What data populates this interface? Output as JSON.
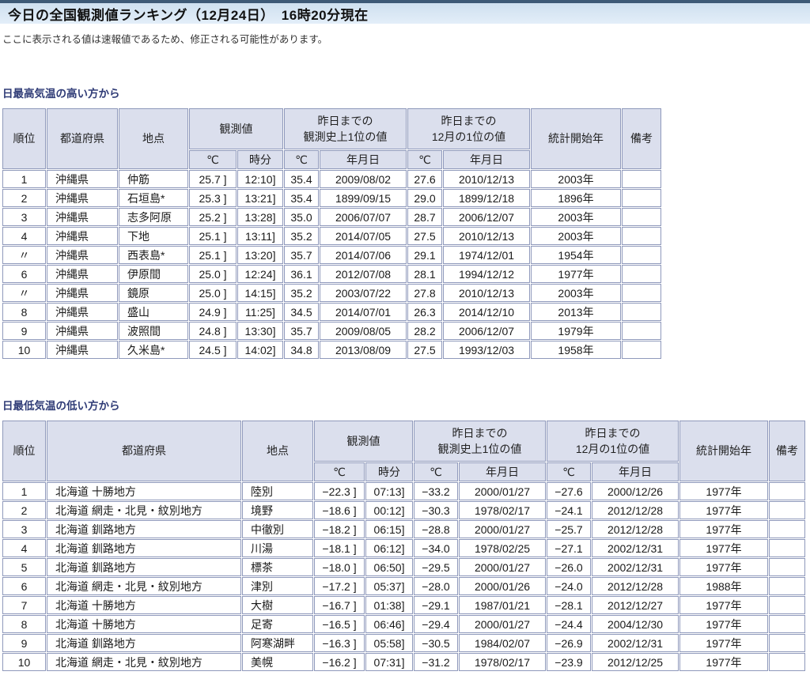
{
  "page": {
    "title": "今日の全国観測値ランキング（12月24日）　16時20分現在",
    "notice": "ここに表示される値は速報値であるため、修正される可能性があります。"
  },
  "colors": {
    "titlebar_top_border": "#3e5a76",
    "titlebar_bg": "#d9e8f5",
    "header_cell_bg": "#dbdfed",
    "table_border": "#8f99bb",
    "section_heading_text": "#2f3b76"
  },
  "columns": {
    "rank": "順位",
    "prefecture": "都道府県",
    "station": "地点",
    "observed": "観測値",
    "record_all_line1": "昨日までの",
    "record_all_line2": "観測史上1位の値",
    "record_dec_line1": "昨日までの",
    "record_dec_line2": "12月の1位の値",
    "stats_start": "統計開始年",
    "remarks": "備考",
    "temp_unit": "℃",
    "time_unit": "時分",
    "date_unit": "年月日"
  },
  "max_table": {
    "heading": "日最高気温の高い方から",
    "rows": [
      [
        "1",
        "沖縄県",
        "仲筋",
        "25.7 ]",
        "12:10]",
        "35.4",
        "2009/08/02",
        "27.6",
        "2010/12/13",
        "2003年",
        ""
      ],
      [
        "2",
        "沖縄県",
        "石垣島*",
        "25.3 ]",
        "13:21]",
        "35.4",
        "1899/09/15",
        "29.0",
        "1899/12/18",
        "1896年",
        ""
      ],
      [
        "3",
        "沖縄県",
        "志多阿原",
        "25.2 ]",
        "13:28]",
        "35.0",
        "2006/07/07",
        "28.7",
        "2006/12/07",
        "2003年",
        ""
      ],
      [
        "4",
        "沖縄県",
        "下地",
        "25.1 ]",
        "13:11]",
        "35.2",
        "2014/07/05",
        "27.5",
        "2010/12/13",
        "2003年",
        ""
      ],
      [
        "〃",
        "沖縄県",
        "西表島*",
        "25.1 ]",
        "13:20]",
        "35.7",
        "2014/07/06",
        "29.1",
        "1974/12/01",
        "1954年",
        ""
      ],
      [
        "6",
        "沖縄県",
        "伊原間",
        "25.0 ]",
        "12:24]",
        "36.1",
        "2012/07/08",
        "28.1",
        "1994/12/12",
        "1977年",
        ""
      ],
      [
        "〃",
        "沖縄県",
        "鏡原",
        "25.0 ]",
        "14:15]",
        "35.2",
        "2003/07/22",
        "27.8",
        "2010/12/13",
        "2003年",
        ""
      ],
      [
        "8",
        "沖縄県",
        "盛山",
        "24.9 ]",
        "11:25]",
        "34.5",
        "2014/07/01",
        "26.3",
        "2014/12/10",
        "2013年",
        ""
      ],
      [
        "9",
        "沖縄県",
        "波照間",
        "24.8 ]",
        "13:30]",
        "35.7",
        "2009/08/05",
        "28.2",
        "2006/12/07",
        "1979年",
        ""
      ],
      [
        "10",
        "沖縄県",
        "久米島*",
        "24.5 ]",
        "14:02]",
        "34.8",
        "2013/08/09",
        "27.5",
        "1993/12/03",
        "1958年",
        ""
      ]
    ]
  },
  "min_table": {
    "heading": "日最低気温の低い方から",
    "rows": [
      [
        "1",
        "北海道 十勝地方",
        "陸別",
        "−22.3 ]",
        "07:13]",
        "−33.2",
        "2000/01/27",
        "−27.6",
        "2000/12/26",
        "1977年",
        ""
      ],
      [
        "2",
        "北海道 網走・北見・紋別地方",
        "境野",
        "−18.6 ]",
        "00:12]",
        "−30.3",
        "1978/02/17",
        "−24.1",
        "2012/12/28",
        "1977年",
        ""
      ],
      [
        "3",
        "北海道 釧路地方",
        "中徹別",
        "−18.2 ]",
        "06:15]",
        "−28.8",
        "2000/01/27",
        "−25.7",
        "2012/12/28",
        "1977年",
        ""
      ],
      [
        "4",
        "北海道 釧路地方",
        "川湯",
        "−18.1 ]",
        "06:12]",
        "−34.0",
        "1978/02/25",
        "−27.1",
        "2002/12/31",
        "1977年",
        ""
      ],
      [
        "5",
        "北海道 釧路地方",
        "標茶",
        "−18.0 ]",
        "06:50]",
        "−29.5",
        "2000/01/27",
        "−26.0",
        "2002/12/31",
        "1977年",
        ""
      ],
      [
        "6",
        "北海道 網走・北見・紋別地方",
        "津別",
        "−17.2 ]",
        "05:37]",
        "−28.0",
        "2000/01/26",
        "−24.0",
        "2012/12/28",
        "1988年",
        ""
      ],
      [
        "7",
        "北海道 十勝地方",
        "大樹",
        "−16.7 ]",
        "01:38]",
        "−29.1",
        "1987/01/21",
        "−28.1",
        "2012/12/27",
        "1977年",
        ""
      ],
      [
        "8",
        "北海道 十勝地方",
        "足寄",
        "−16.5 ]",
        "06:46]",
        "−29.4",
        "2000/01/27",
        "−24.4",
        "2004/12/30",
        "1977年",
        ""
      ],
      [
        "9",
        "北海道 釧路地方",
        "阿寒湖畔",
        "−16.3 ]",
        "05:58]",
        "−30.5",
        "1984/02/07",
        "−26.9",
        "2002/12/31",
        "1977年",
        ""
      ],
      [
        "10",
        "北海道 網走・北見・紋別地方",
        "美幌",
        "−16.2 ]",
        "07:31]",
        "−31.2",
        "1978/02/17",
        "−23.9",
        "2012/12/25",
        "1977年",
        ""
      ]
    ]
  }
}
